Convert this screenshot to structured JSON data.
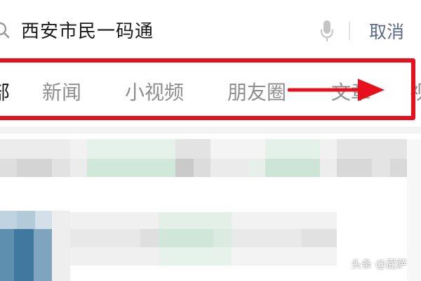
{
  "search": {
    "query": "西安市民一码通",
    "cancel_label": "取消"
  },
  "tabs": [
    {
      "label": "部"
    },
    {
      "label": "新闻"
    },
    {
      "label": "小视频"
    },
    {
      "label": "朋友圈"
    },
    {
      "label": "文章"
    },
    {
      "label": "视"
    }
  ],
  "annotation": {
    "box_color": "#e8101c",
    "arrow_color": "#e8101c",
    "arrow_direction": "right"
  },
  "watermark": "头条 @屁萨",
  "icons": [
    "search-icon",
    "mic-icon",
    "arrow-right-icon"
  ],
  "colors": {
    "cancel": "#5b6a8c",
    "tab_inactive": "#8e8e8e",
    "tab_active": "#1a1a1a",
    "highlight": "#e8101c"
  }
}
